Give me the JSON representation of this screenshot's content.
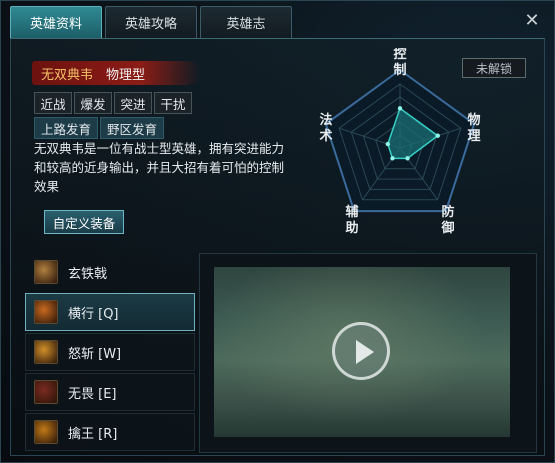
{
  "tabs": [
    {
      "label": "英雄资料",
      "active": true
    },
    {
      "label": "英雄攻略",
      "active": false
    },
    {
      "label": "英雄志",
      "active": false
    }
  ],
  "close_icon": "✕",
  "hero": {
    "name": "无双典韦",
    "type": "物理型",
    "tags": [
      "近战",
      "爆发",
      "突进",
      "干扰"
    ],
    "lanes": [
      "上路发育",
      "野区发育"
    ],
    "description": "无双典韦是一位有战士型英雄，拥有突进能力和较高的近身输出，并且大招有着可怕的控制效果",
    "custom_equip_label": "自定义装备"
  },
  "unlock_label": "未解锁",
  "radar": {
    "axes": [
      {
        "label_top": "控",
        "label_bottom": "制",
        "value": 0.62
      },
      {
        "label_top": "物",
        "label_bottom": "理",
        "value": 0.62
      },
      {
        "label_top": "防",
        "label_bottom": "御",
        "value": 0.2
      },
      {
        "label_top": "辅",
        "label_bottom": "助",
        "value": 0.2
      },
      {
        "label_top": "法",
        "label_bottom": "术",
        "value": 0.2
      }
    ],
    "colors": {
      "fill": "#1b6e73",
      "stroke": "#33d1c6",
      "grid": "#2a4a55"
    }
  },
  "skills": [
    {
      "label": "玄铁戟",
      "icon": "halberd-icon",
      "color": "#b08040"
    },
    {
      "label": "横行 [Q]",
      "icon": "charge-icon",
      "color": "#c86a20"
    },
    {
      "label": "怒斩 [W]",
      "icon": "slash-icon",
      "color": "#d0902a"
    },
    {
      "label": "无畏 [E]",
      "icon": "fearless-icon",
      "color": "#7a2a20"
    },
    {
      "label": "擒王 [R]",
      "icon": "seize-icon",
      "color": "#c07a18"
    }
  ],
  "active_skill": 1,
  "video": {
    "play_icon": "play-icon"
  }
}
